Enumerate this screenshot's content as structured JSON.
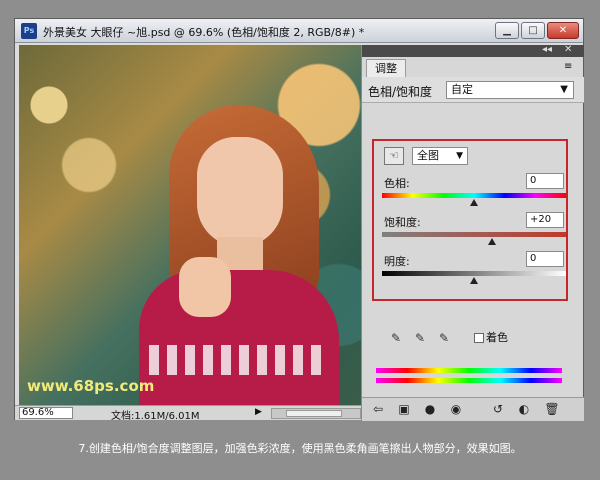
{
  "window": {
    "app_icon": "Ps",
    "title": "外景美女 大眼仔 ~旭.psd @ 69.6% (色相/饱和度 2, RGB/8#) *",
    "controls": {
      "minimize": "▁",
      "maximize": "□",
      "close": "✕"
    }
  },
  "canvas": {
    "watermark": "www.68ps.com"
  },
  "statusbar": {
    "zoom": "69.6%",
    "doc_info": "文档:1.61M/6.01M",
    "arrow": "▶"
  },
  "panel": {
    "collapse": "◂◂",
    "close": "✕",
    "tab_label": "调整",
    "menu_icon": "≡",
    "adjustment_type": "色相/饱和度",
    "preset": {
      "value": "自定",
      "arrow": "▼"
    },
    "target_tool_glyph": "☜",
    "range": {
      "value": "全图",
      "arrow": "▼"
    },
    "hue": {
      "label": "色相:",
      "value": "0",
      "level": 0.5
    },
    "saturation": {
      "label": "饱和度:",
      "value": "+20",
      "level": 0.6
    },
    "lightness": {
      "label": "明度:",
      "value": "0",
      "level": 0.5
    },
    "eyedropper_glyphs": [
      "✎",
      "✎",
      "✎"
    ],
    "colorize_label": "着色",
    "footer_glyphs": [
      "⇦",
      "▣",
      "●",
      "◉",
      "↺",
      "◐",
      "🗑"
    ]
  },
  "caption": "7.创建色相/饱合度调整图层，加强色彩浓度，使用黑色柔角画笔擦出人物部分，效果如图。",
  "colors": {
    "accent_box": "#c3262b",
    "watermark": "#f2ea7a",
    "background": "#8e8e8e"
  }
}
